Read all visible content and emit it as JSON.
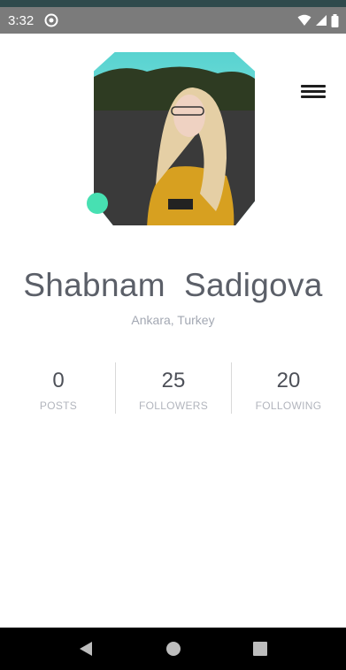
{
  "status_bar": {
    "time": "3:32"
  },
  "profile": {
    "name": "Shabnam  Sadigova",
    "location": "Ankara, Turkey"
  },
  "stats": [
    {
      "value": "0",
      "label": "POSTS"
    },
    {
      "value": "25",
      "label": "FOLLOWERS"
    },
    {
      "value": "20",
      "label": "FOLLOWING"
    }
  ],
  "icons": {
    "menu": "hamburger-menu-icon",
    "back": "back-icon",
    "home": "home-icon",
    "recents": "recents-icon"
  },
  "colors": {
    "status_bar": "#7b7b7b",
    "online_dot": "#47e0b2",
    "name_text": "#5b5f68",
    "muted_text": "#a3a8b3"
  }
}
